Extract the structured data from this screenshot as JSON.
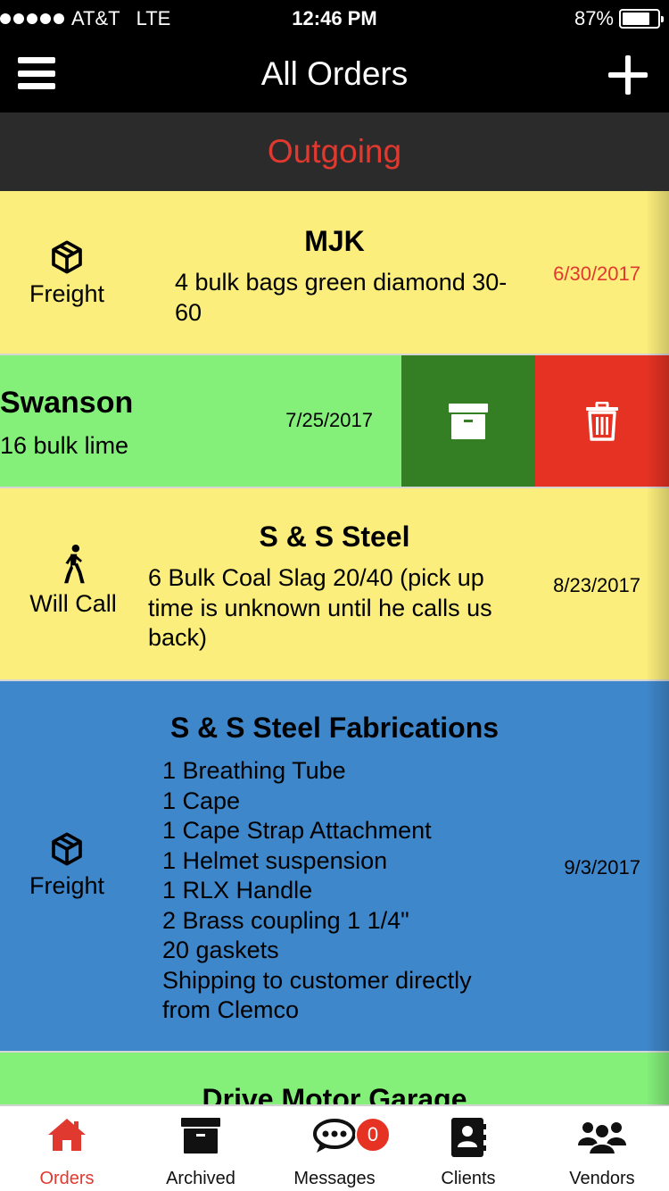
{
  "status_bar": {
    "carrier": "AT&T",
    "network": "LTE",
    "time": "12:46 PM",
    "battery": "87%",
    "battery_level": 0.87
  },
  "nav": {
    "title": "All Orders",
    "menu_icon": "hamburger-icon",
    "add_icon": "plus-icon"
  },
  "section": {
    "title": "Outgoing"
  },
  "orders": [
    {
      "client": "MJK",
      "shipping": "Freight",
      "shipping_icon": "package-icon",
      "description": "4 bulk bags green diamond 30-60",
      "date": "6/30/2017",
      "color": "#fbee7c",
      "date_color": "#e0392f"
    },
    {
      "client": "Swanson",
      "description": "16 bulk lime",
      "date": "7/25/2017",
      "color": "#84f07a",
      "actions": {
        "archive_icon": "archive-box-icon",
        "delete_icon": "trash-icon",
        "archive_color": "#347f23",
        "delete_color": "#e63223"
      }
    },
    {
      "client": "S & S Steel",
      "shipping": "Will Call",
      "shipping_icon": "walking-person-icon",
      "description": "6 Bulk Coal Slag 20/40 (pick up time is unknown until he calls us back)",
      "date": "8/23/2017",
      "color": "#fbee7c"
    },
    {
      "client": "S & S Steel Fabrications",
      "shipping": "Freight",
      "shipping_icon": "package-icon",
      "description_lines": [
        "1 Breathing Tube",
        "1 Cape",
        "1 Cape Strap Attachment",
        "1 Helmet suspension",
        "1 RLX Handle",
        "2 Brass coupling 1 1/4\"",
        "20 gaskets",
        "Shipping to customer directly",
        "from Clemco"
      ],
      "date": "9/3/2017",
      "color": "#3f87cb"
    },
    {
      "client": "Drive Motor Garage",
      "color": "#84f07a"
    }
  ],
  "tabs": [
    {
      "label": "Orders",
      "icon": "home-icon",
      "active": true
    },
    {
      "label": "Archived",
      "icon": "archive-box-icon"
    },
    {
      "label": "Messages",
      "icon": "chat-bubble-icon",
      "badge": "0"
    },
    {
      "label": "Clients",
      "icon": "contacts-book-icon"
    },
    {
      "label": "Vendors",
      "icon": "group-icon"
    }
  ],
  "colors": {
    "accent": "#e0392f",
    "header_bg": "#000000",
    "section_bg": "#2b2b2b"
  }
}
